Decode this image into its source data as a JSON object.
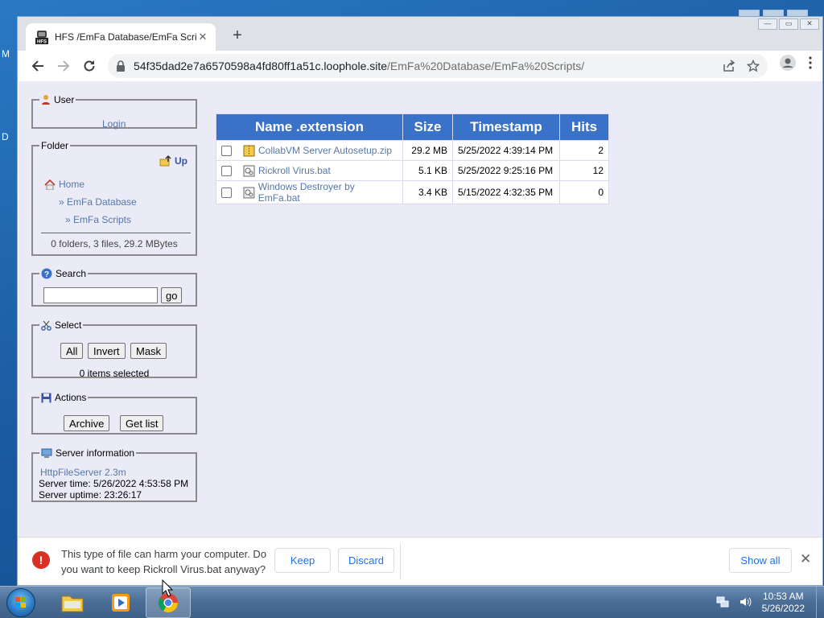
{
  "desktop": {
    "left_letter_1": "M",
    "left_letter_2": "D"
  },
  "browser": {
    "tab_title": "HFS /EmFa Database/EmFa Scripts/",
    "url_domain": "54f35dad2e7a6570598a4fd80ff1a51c.loophole.site",
    "url_path": "/EmFa%20Database/EmFa%20Scripts/",
    "new_tab": "+",
    "tab_close": "✕"
  },
  "user_panel": {
    "legend": "User",
    "login": "Login"
  },
  "folder_panel": {
    "legend": "Folder",
    "up": "Up",
    "home": "Home",
    "crumb1": "» EmFa Database",
    "crumb2": "» EmFa Scripts",
    "summary": "0 folders, 3 files, 29.2 MBytes"
  },
  "search_panel": {
    "legend": "Search",
    "value": "",
    "go": "go"
  },
  "select_panel": {
    "legend": "Select",
    "all": "All",
    "invert": "Invert",
    "mask": "Mask",
    "status": "0 items selected"
  },
  "actions_panel": {
    "legend": "Actions",
    "archive": "Archive",
    "get_list": "Get list"
  },
  "server_panel": {
    "legend": "Server information",
    "software": "HttpFileServer 2.3m",
    "time": "Server time: 5/26/2022 4:53:58 PM",
    "uptime": "Server uptime: 23:26:17"
  },
  "table": {
    "headers": [
      "Name .extension",
      "Size",
      "Timestamp",
      "Hits"
    ],
    "rows": [
      {
        "name": "CollabVM Server Autosetup.zip",
        "size": "29.2 MB",
        "timestamp": "5/25/2022 4:39:14 PM",
        "hits": "2",
        "icon": "zip-archive-icon"
      },
      {
        "name": "Rickroll Virus.bat",
        "size": "5.1 KB",
        "timestamp": "5/25/2022 9:25:16 PM",
        "hits": "12",
        "icon": "batch-file-icon"
      },
      {
        "name": "Windows Destroyer by EmFa.bat",
        "size": "3.4 KB",
        "timestamp": "5/15/2022 4:32:35 PM",
        "hits": "0",
        "icon": "batch-file-icon"
      }
    ]
  },
  "download_bar": {
    "message": "This type of file can harm your computer. Do you want to keep Rickroll Virus.bat anyway?",
    "keep": "Keep",
    "discard": "Discard",
    "show_all": "Show all",
    "warning_glyph": "!",
    "close": "✕"
  },
  "taskbar": {
    "time": "10:53 AM",
    "date": "5/26/2022"
  },
  "colors": {
    "table_header": "#3b72c9",
    "link": "#5577aa",
    "page_bg": "#ebebf8",
    "warning": "#d93025",
    "chrome_blue": "#1a73e8"
  }
}
